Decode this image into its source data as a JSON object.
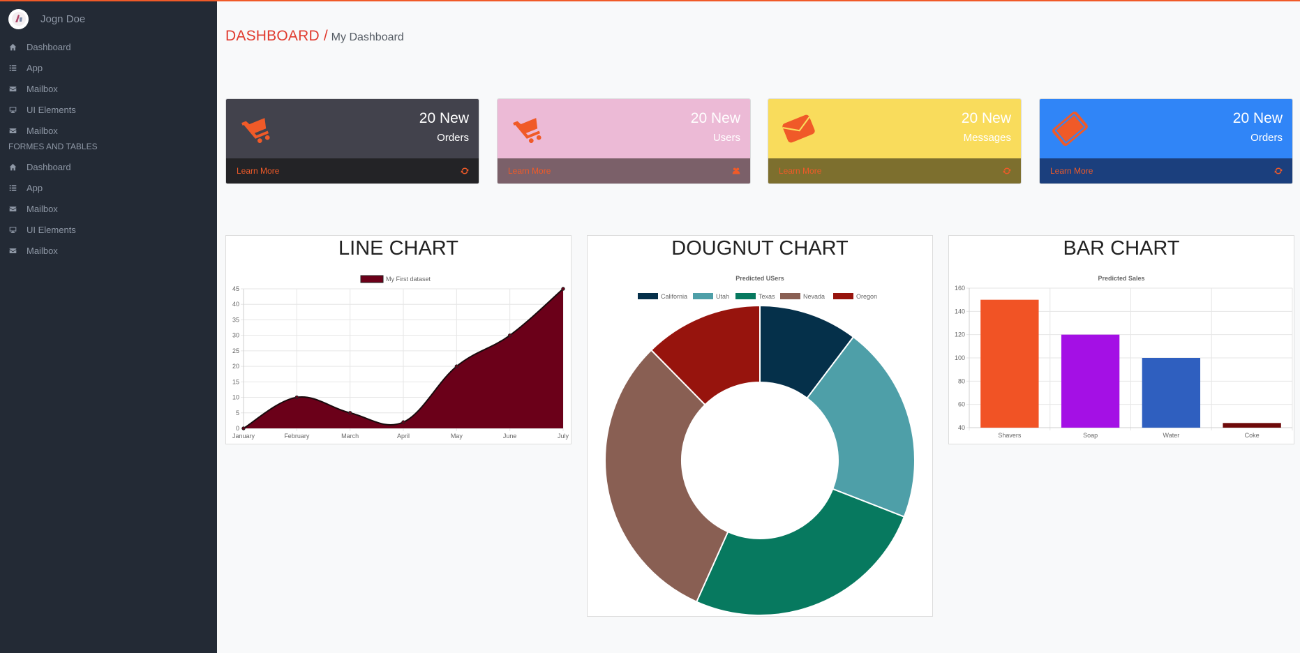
{
  "sidebar": {
    "user_name": "Jogn Doe",
    "items": [
      {
        "label": "Dashboard",
        "icon": "home-icon"
      },
      {
        "label": "App",
        "icon": "list-icon"
      },
      {
        "label": "Mailbox",
        "icon": "envelope-icon"
      },
      {
        "label": "UI Elements",
        "icon": "desktop-icon"
      },
      {
        "label": "Mailbox",
        "icon": "envelope-icon"
      }
    ],
    "section_title": "FORMES AND TABLES",
    "section_items": [
      {
        "label": "Dashboard",
        "icon": "home-icon"
      },
      {
        "label": "App",
        "icon": "list-icon"
      },
      {
        "label": "Mailbox",
        "icon": "envelope-icon"
      },
      {
        "label": "UI Elements",
        "icon": "desktop-icon"
      },
      {
        "label": "Mailbox",
        "icon": "envelope-icon"
      }
    ]
  },
  "breadcrumb": {
    "main": "DASHBOARD",
    "separator": "/",
    "sub": "My Dashboard"
  },
  "cards": [
    {
      "number": "20 New",
      "label": "Orders",
      "link": "Learn More",
      "icon": "shopping-cart-icon",
      "footer_icon": "refresh-icon",
      "color": "#42424c",
      "footer_color": "#232326"
    },
    {
      "number": "20 New",
      "label": "Users",
      "link": "Learn More",
      "icon": "shopping-cart-icon",
      "footer_icon": "users-icon",
      "color": "#ecbad6",
      "footer_color": "#7b6069"
    },
    {
      "number": "20 New",
      "label": "Messages",
      "link": "Learn More",
      "icon": "envelope-icon",
      "footer_icon": "refresh-icon",
      "color": "#f9dc5c",
      "footer_color": "#7d6f2e"
    },
    {
      "number": "20 New",
      "label": "Orders",
      "link": "Learn More",
      "icon": "tablet-icon",
      "footer_icon": "refresh-icon",
      "color": "#3085f7",
      "footer_color": "#1b3f7d"
    }
  ],
  "panels": {
    "line": "LINE CHART",
    "doughnut": "DOUGNUT CHART",
    "bar": "BAR CHART"
  },
  "chart_data": [
    {
      "type": "area",
      "title": "",
      "legend": {
        "placement": "top"
      },
      "categories": [
        "January",
        "February",
        "March",
        "April",
        "May",
        "June",
        "July"
      ],
      "series": [
        {
          "name": "My First dataset",
          "values": [
            0,
            10,
            5,
            2,
            20,
            30,
            45
          ],
          "color": "#6b0019"
        }
      ],
      "ylim": [
        0,
        45
      ],
      "yticks": [
        0,
        5,
        10,
        15,
        20,
        25,
        30,
        35,
        40,
        45
      ],
      "grid": true
    },
    {
      "type": "pie",
      "title": "Predicted USers",
      "legend": {
        "placement": "top"
      },
      "labels": [
        "California",
        "Utah",
        "Texas",
        "Nevada",
        "Oregon"
      ],
      "values": [
        10,
        20,
        25,
        30,
        12
      ],
      "colors": [
        "#05304a",
        "#4e9fa8",
        "#07795f",
        "#895f53",
        "#97140d"
      ]
    },
    {
      "type": "bar",
      "title": "Predicted Sales",
      "categories": [
        "Shavers",
        "Soap",
        "Water",
        "Coke"
      ],
      "values": [
        150,
        120,
        100,
        44
      ],
      "colors": [
        "#f15325",
        "#a410e5",
        "#2f5fbf",
        "#6e0a0a"
      ],
      "ylim": [
        40,
        160
      ],
      "yticks": [
        40,
        60,
        80,
        100,
        120,
        140,
        160
      ],
      "grid": true
    }
  ]
}
